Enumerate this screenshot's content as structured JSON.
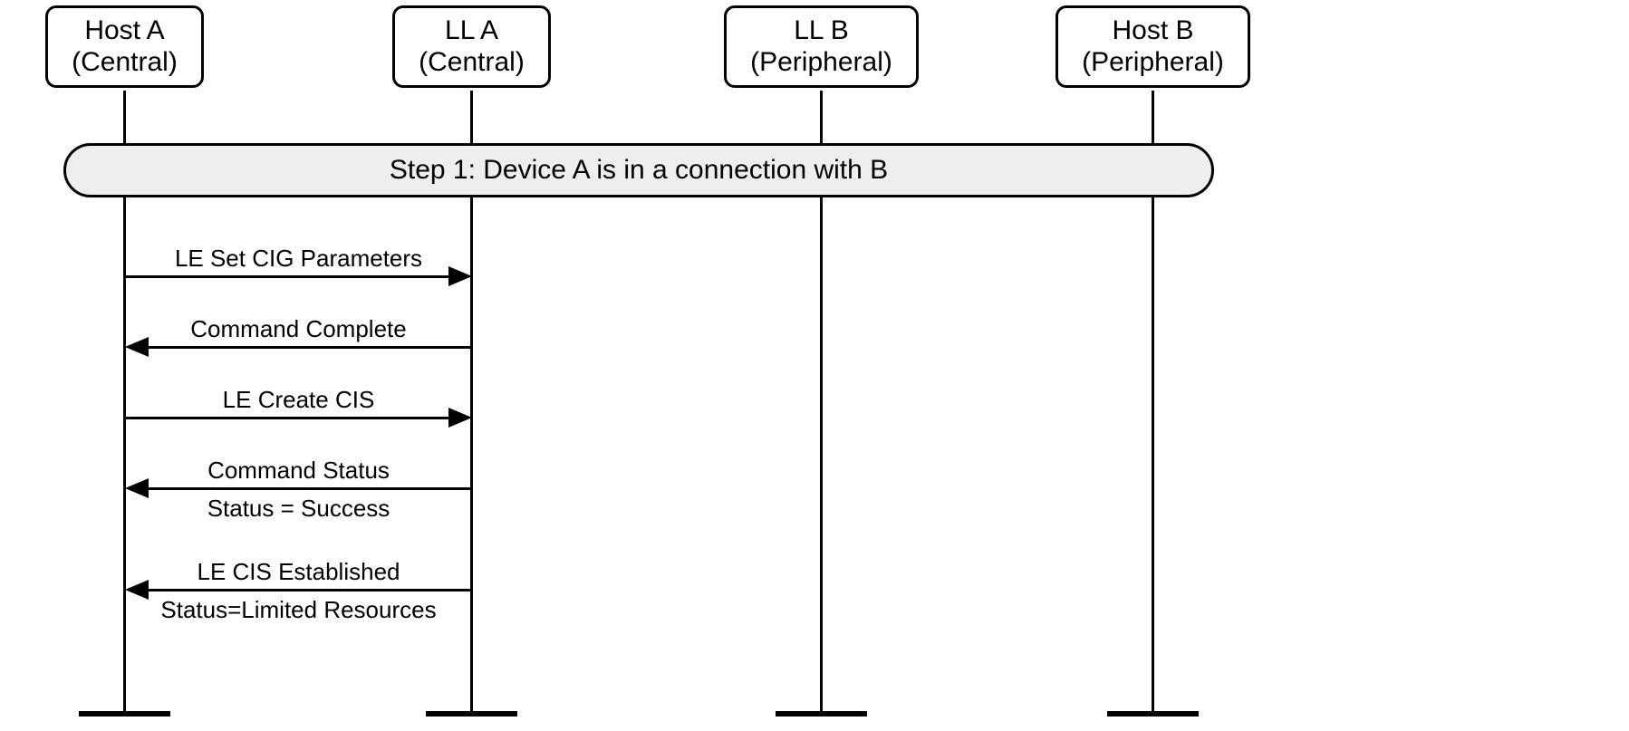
{
  "participants": {
    "hostA": {
      "line1": "Host A",
      "line2": "(Central)"
    },
    "llA": {
      "line1": "LL A",
      "line2": "(Central)"
    },
    "llB": {
      "line1": "LL B",
      "line2": "(Peripheral)"
    },
    "hostB": {
      "line1": "Host B",
      "line2": "(Peripheral)"
    }
  },
  "step": {
    "label": "Step 1:  Device A is in a connection with B"
  },
  "messages": {
    "m1": {
      "label": "LE Set CIG Parameters"
    },
    "m2": {
      "label": "Command Complete"
    },
    "m3": {
      "label": "LE Create CIS"
    },
    "m4": {
      "label": "Command Status",
      "sublabel": "Status = Success"
    },
    "m5": {
      "label": "LE CIS Established",
      "sublabel": "Status=Limited Resources"
    }
  }
}
